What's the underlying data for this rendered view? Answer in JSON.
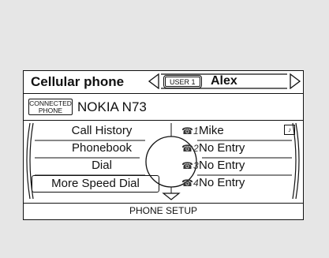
{
  "header": {
    "title": "Cellular phone",
    "user_badge": "USER 1",
    "user_name": "Alex"
  },
  "connection": {
    "badge_line1": "CONNECTED",
    "badge_line2": "PHONE",
    "device_name": "NOKIA N73"
  },
  "menu": {
    "items": [
      {
        "label": "Call History",
        "selected": false
      },
      {
        "label": "Phonebook",
        "selected": false
      },
      {
        "label": "Dial",
        "selected": false
      },
      {
        "label": "More Speed Dial",
        "selected": true
      }
    ]
  },
  "speed_dial": {
    "entries": [
      {
        "slot": "1",
        "name": "Mike"
      },
      {
        "slot": "2",
        "name": "No Entry"
      },
      {
        "slot": "3",
        "name": "No Entry"
      },
      {
        "slot": "4",
        "name": "No Entry"
      }
    ],
    "voice_tag_icon": "voice-tag-icon"
  },
  "footer": {
    "label": "PHONE SETUP"
  }
}
